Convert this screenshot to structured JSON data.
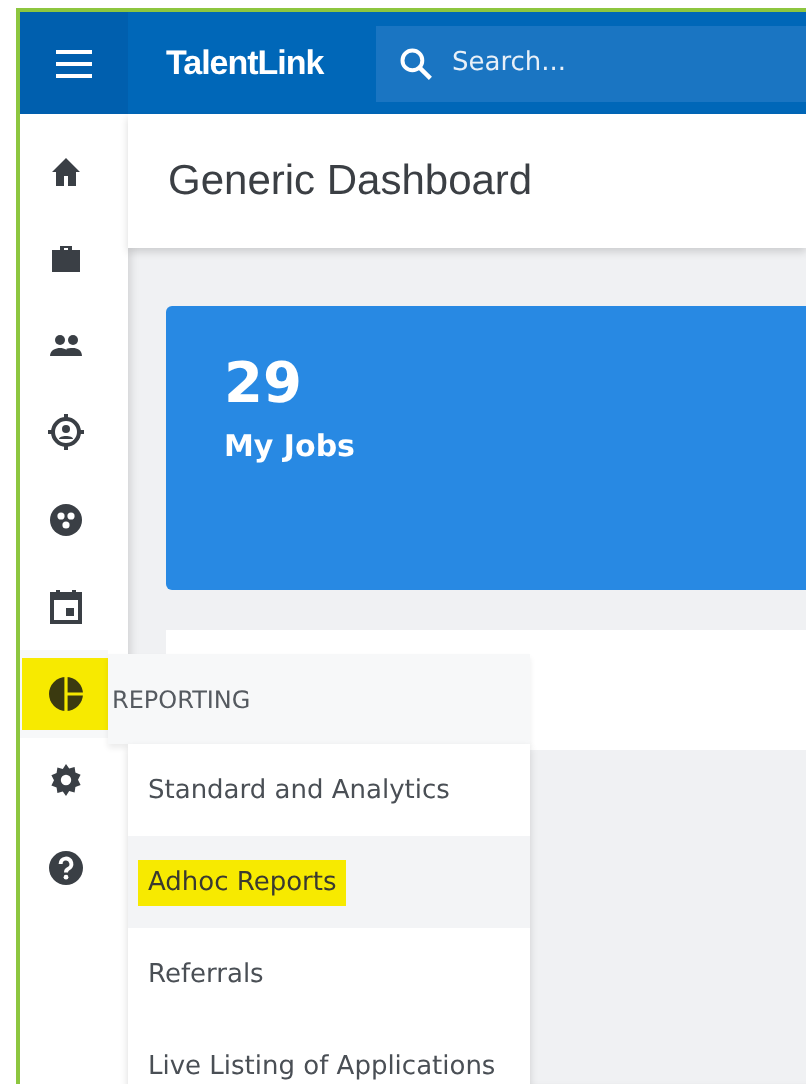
{
  "header": {
    "logo": "TalentLink",
    "search": {
      "placeholder": "Search..."
    }
  },
  "sidebar": {
    "items": [
      {
        "highlighted": false
      },
      {
        "highlighted": false
      },
      {
        "highlighted": false
      },
      {
        "highlighted": false
      },
      {
        "highlighted": false
      },
      {
        "highlighted": false
      },
      {
        "highlighted": true
      },
      {
        "highlighted": false
      },
      {
        "highlighted": false
      }
    ]
  },
  "page_title": "Generic Dashboard",
  "tiles": [
    {
      "count": "29",
      "label": "My Jobs"
    }
  ],
  "flyout": {
    "title": "REPORTING",
    "items": [
      {
        "label": "Standard and Analytics",
        "selected": false,
        "highlighted": false
      },
      {
        "label": "Adhoc Reports",
        "selected": true,
        "highlighted": true
      },
      {
        "label": "Referrals",
        "selected": false,
        "highlighted": false
      },
      {
        "label": "Live Listing of Applications",
        "selected": false,
        "highlighted": false
      }
    ]
  }
}
